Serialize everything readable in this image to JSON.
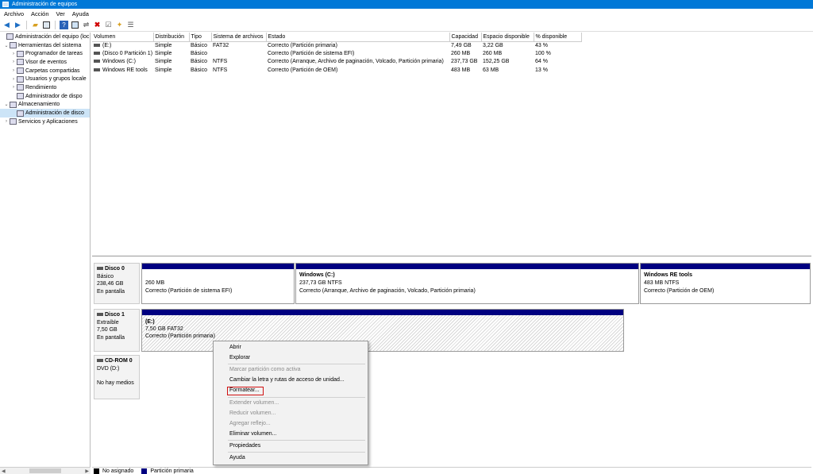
{
  "window": {
    "title": "Administración de equipos"
  },
  "menubar": [
    "Archivo",
    "Acción",
    "Ver",
    "Ayuda"
  ],
  "tree": [
    {
      "label": "Administración del equipo (loc",
      "indent": 0,
      "arrow": "",
      "sel": false
    },
    {
      "label": "Herramientas del sistema",
      "indent": 1,
      "arrow": "⌄",
      "sel": false
    },
    {
      "label": "Programador de tareas",
      "indent": 2,
      "arrow": "›",
      "sel": false
    },
    {
      "label": "Visor de eventos",
      "indent": 2,
      "arrow": "›",
      "sel": false
    },
    {
      "label": "Carpetas compartidas",
      "indent": 2,
      "arrow": "›",
      "sel": false
    },
    {
      "label": "Usuarios y grupos locale",
      "indent": 2,
      "arrow": "›",
      "sel": false
    },
    {
      "label": "Rendimiento",
      "indent": 2,
      "arrow": "›",
      "sel": false
    },
    {
      "label": "Administrador de dispo",
      "indent": 2,
      "arrow": "",
      "sel": false
    },
    {
      "label": "Almacenamiento",
      "indent": 1,
      "arrow": "⌄",
      "sel": false
    },
    {
      "label": "Administración de disco",
      "indent": 2,
      "arrow": "",
      "sel": true
    },
    {
      "label": "Servicios y Aplicaciones",
      "indent": 1,
      "arrow": "›",
      "sel": false
    }
  ],
  "volumes": {
    "headers": [
      "Volumen",
      "Distribución",
      "Tipo",
      "Sistema de archivos",
      "Estado",
      "Capacidad",
      "Espacio disponible",
      "% disponible"
    ],
    "rows": [
      [
        "(E:)",
        "Simple",
        "Básico",
        "FAT32",
        "Correcto (Partición primaria)",
        "7,49 GB",
        "3,22 GB",
        "43 %"
      ],
      [
        "(Disco 0 Partición 1)",
        "Simple",
        "Básico",
        "",
        "Correcto (Partición de sistema EFI)",
        "260 MB",
        "260 MB",
        "100 %"
      ],
      [
        "Windows (C:)",
        "Simple",
        "Básico",
        "NTFS",
        "Correcto (Arranque, Archivo de paginación, Volcado, Partición primaria)",
        "237,73 GB",
        "152,25 GB",
        "64 %"
      ],
      [
        "Windows RE tools",
        "Simple",
        "Básico",
        "NTFS",
        "Correcto (Partición de OEM)",
        "483 MB",
        "63 MB",
        "13 %"
      ]
    ]
  },
  "disks": {
    "disk0": {
      "name": "Disco 0",
      "type": "Básico",
      "size": "238,46 GB",
      "status": "En pantalla",
      "p1": {
        "size": "260 MB",
        "status": "Correcto (Partición de sistema EFI)"
      },
      "p2": {
        "name": "Windows (C:)",
        "size": "237,73 GB NTFS",
        "status": "Correcto (Arranque, Archivo de paginación, Volcado, Partición primaria)"
      },
      "p3": {
        "name": "Windows RE tools",
        "size": "483 MB NTFS",
        "status": "Correcto (Partición de OEM)"
      }
    },
    "disk1": {
      "name": "Disco 1",
      "type": "Extraíble",
      "size": "7,50 GB",
      "status": "En pantalla",
      "p1": {
        "name": "(E:)",
        "size": "7,50 GB FAT32",
        "status": "Correcto (Partición primaria)"
      }
    },
    "cdrom": {
      "name": "CD-ROM 0",
      "type": "DVD (D:)",
      "status": "No hay medios"
    }
  },
  "legend": {
    "unallocated": "No asignado",
    "primary": "Partición primaria",
    "unallocated_color": "#000000",
    "primary_color": "#000080"
  },
  "context_menu": {
    "abrir": "Abrir",
    "explorar": "Explorar",
    "marcar": "Marcar partición como activa",
    "cambiar": "Cambiar la letra y rutas de acceso de unidad...",
    "formatear": "Formatear...",
    "extender": "Extender volumen...",
    "reducir": "Reducir volumen...",
    "agregar": "Agregar reflejo...",
    "eliminar": "Eliminar volumen...",
    "propiedades": "Propiedades",
    "ayuda": "Ayuda"
  }
}
